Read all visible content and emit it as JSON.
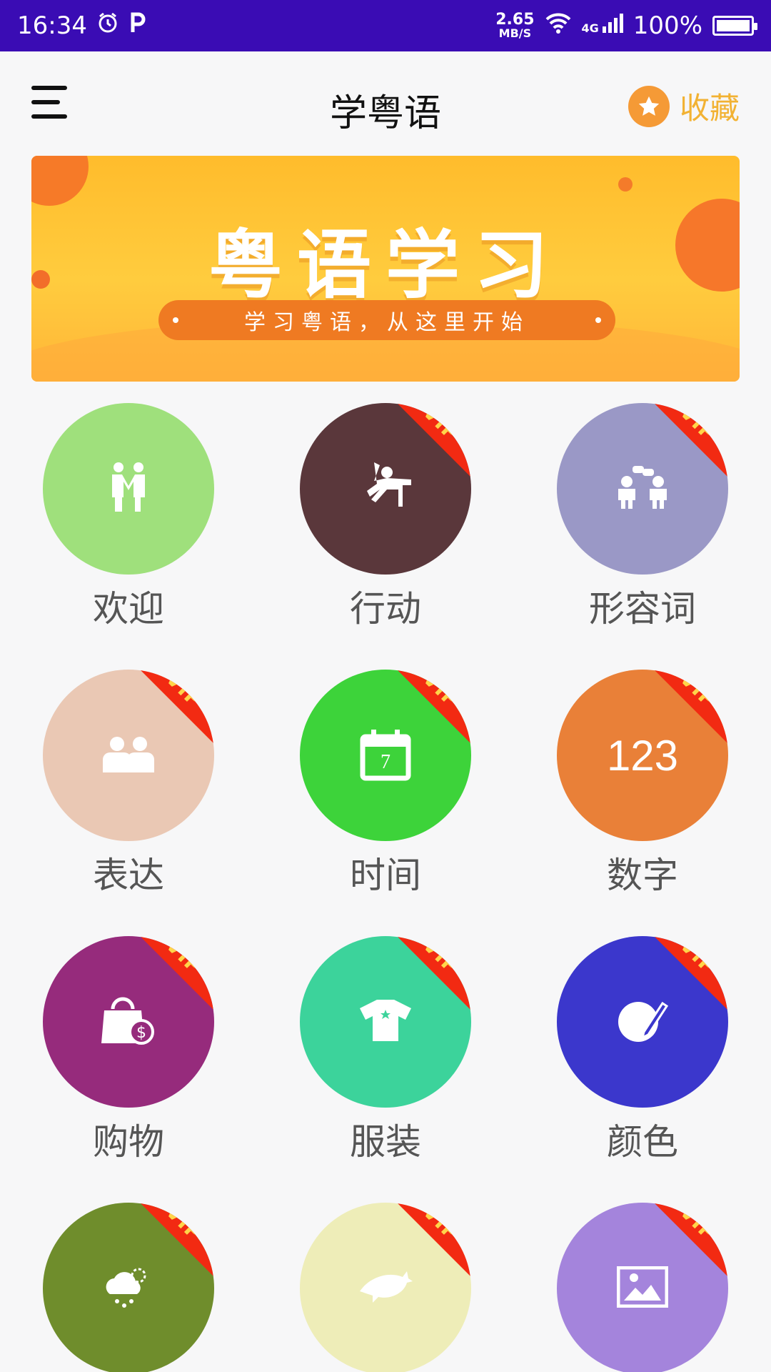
{
  "status_bar": {
    "time": "16:34",
    "speed_value": "2.65",
    "speed_unit": "MB/S",
    "network": "4G",
    "battery": "100%",
    "icons": [
      "alarm-icon",
      "parking-icon",
      "wifi-icon",
      "signal-icon",
      "battery-icon"
    ]
  },
  "app_bar": {
    "title": "学粤语",
    "favorite_label": "收藏",
    "menu_icon": "hamburger-menu-icon",
    "favorite_icon": "star-icon"
  },
  "banner": {
    "title": "粤语学习",
    "subtitle": "学习粤语，从这里开始"
  },
  "categories": [
    {
      "label": "欢迎",
      "color": "#9fe07c",
      "vip": false,
      "icon": "handshake-people-icon"
    },
    {
      "label": "行动",
      "color": "#5a373b",
      "vip": true,
      "vip_text": "VIP",
      "icon": "person-at-desk-icon"
    },
    {
      "label": "形容词",
      "color": "#9a98c6",
      "vip": true,
      "vip_text": "VIP",
      "icon": "conversation-icon"
    },
    {
      "label": "表达",
      "color": "#eac8b4",
      "vip": true,
      "vip_text": "VIP",
      "icon": "two-people-icon"
    },
    {
      "label": "时间",
      "color": "#3dd33a",
      "vip": true,
      "vip_text": "VIP",
      "icon": "calendar-icon",
      "icon_text": "7"
    },
    {
      "label": "数字",
      "color": "#e98038",
      "vip": true,
      "vip_text": "VIP",
      "icon": "numbers-icon",
      "icon_text": "123"
    },
    {
      "label": "购物",
      "color": "#962b7c",
      "vip": true,
      "vip_text": "VIP",
      "icon": "shopping-bag-icon"
    },
    {
      "label": "服装",
      "color": "#3cd39b",
      "vip": true,
      "vip_text": "VIP",
      "icon": "tshirt-icon"
    },
    {
      "label": "颜色",
      "color": "#3b37cc",
      "vip": true,
      "vip_text": "VIP",
      "icon": "palette-brush-icon"
    },
    {
      "label": "",
      "color": "#6f8d2c",
      "vip": true,
      "vip_text": "VIP",
      "icon": "weather-icon"
    },
    {
      "label": "",
      "color": "#eeedb8",
      "vip": true,
      "vip_text": "VIP",
      "icon": "dolphin-icon"
    },
    {
      "label": "",
      "color": "#a484dc",
      "vip": true,
      "vip_text": "VIP",
      "icon": "picture-icon"
    }
  ]
}
